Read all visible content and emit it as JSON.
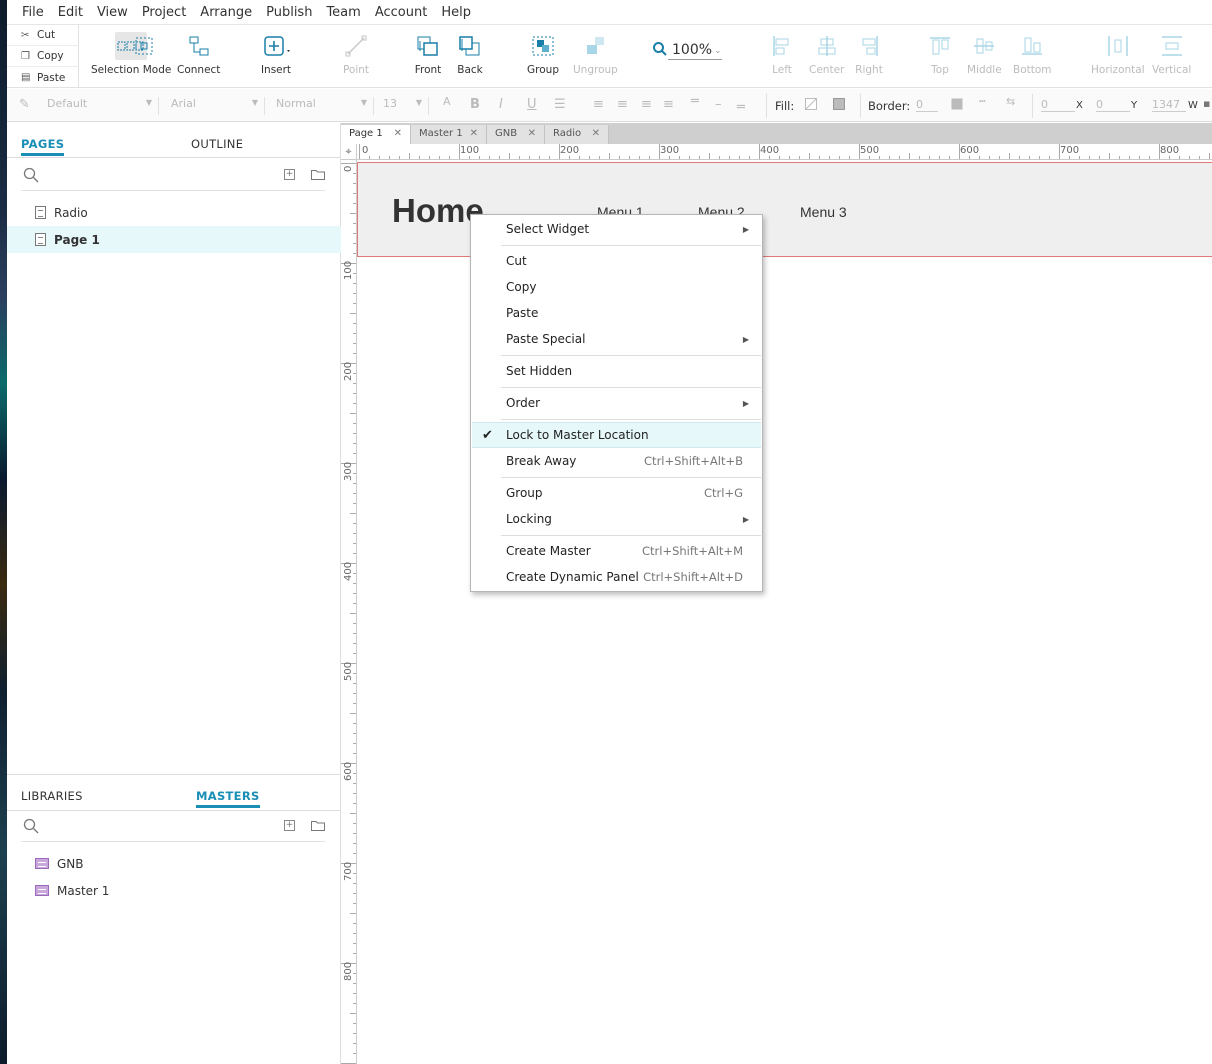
{
  "menubar": [
    "File",
    "Edit",
    "View",
    "Project",
    "Arrange",
    "Publish",
    "Team",
    "Account",
    "Help"
  ],
  "clipboard": {
    "cut": "Cut",
    "copy": "Copy",
    "paste": "Paste"
  },
  "toolbar": {
    "selection_mode": "Selection Mode",
    "connect": "Connect",
    "insert": "Insert",
    "point": "Point",
    "front": "Front",
    "back": "Back",
    "group": "Group",
    "ungroup": "Ungroup",
    "zoom": "100%",
    "left": "Left",
    "center": "Center",
    "right": "Right",
    "top": "Top",
    "middle": "Middle",
    "bottom": "Bottom",
    "horizontal": "Horizontal",
    "vertical": "Vertical"
  },
  "formatbar": {
    "style": "Default",
    "font": "Arial",
    "weight": "Normal",
    "size": "13",
    "fill_label": "Fill:",
    "border_label": "Border:",
    "border_value": "0",
    "x_value": "0",
    "x_label": "X",
    "y_value": "0",
    "y_label": "Y",
    "w_value": "1347",
    "w_label": "W"
  },
  "left_panel": {
    "tab_pages": "PAGES",
    "tab_outline": "OUTLINE",
    "pages": [
      "Radio",
      "Page 1"
    ],
    "tab_libraries": "LIBRARIES",
    "tab_masters": "MASTERS",
    "masters": [
      "GNB",
      "Master 1"
    ]
  },
  "doc_tabs": [
    "Page 1",
    "Master 1",
    "GNB",
    "Radio"
  ],
  "ruler": {
    "h": [
      "0",
      "100",
      "200",
      "300",
      "400",
      "500",
      "600",
      "700",
      "800"
    ],
    "v": [
      "0",
      "100",
      "200",
      "300",
      "400",
      "500",
      "600",
      "700",
      "800"
    ]
  },
  "canvas": {
    "home": "Home",
    "menus": [
      "Menu 1",
      "Menu 2",
      "Menu 3"
    ]
  },
  "context_menu": {
    "select_widget": "Select Widget",
    "cut": "Cut",
    "copy": "Copy",
    "paste": "Paste",
    "paste_special": "Paste Special",
    "set_hidden": "Set Hidden",
    "order": "Order",
    "lock_to_master": "Lock to Master Location",
    "break_away": "Break Away",
    "break_away_sc": "Ctrl+Shift+Alt+B",
    "group": "Group",
    "group_sc": "Ctrl+G",
    "locking": "Locking",
    "create_master": "Create Master",
    "create_master_sc": "Ctrl+Shift+Alt+M",
    "create_dynamic_panel": "Create Dynamic Panel",
    "create_dynamic_panel_sc": "Ctrl+Shift+Alt+D"
  },
  "colors": {
    "accent": "#1a8fb5",
    "selection": "#e6f8fa",
    "master_outline": "#e07a7a"
  }
}
